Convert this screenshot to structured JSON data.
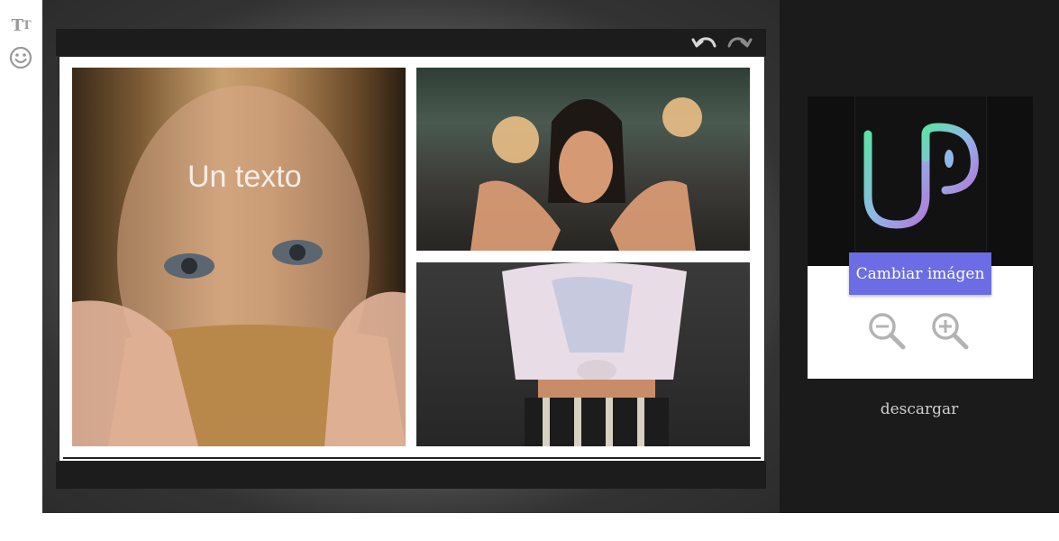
{
  "tools": {
    "text_glyph_big": "T",
    "text_glyph_small": "T"
  },
  "icons": {
    "text_tool": "text-size-icon",
    "emoji_tool": "smiley-icon",
    "undo": "undo-icon",
    "redo": "redo-icon",
    "zoom_out": "zoom-out-icon",
    "zoom_in": "zoom-in-icon"
  },
  "canvas": {
    "overlay_text": "Un texto"
  },
  "panel": {
    "change_image_label": "Cambiar imágen",
    "download_label": "descargar"
  },
  "colors": {
    "accent": "#6c6ce4",
    "panel_bg": "#1b1b1b",
    "logo_bg": "#0f0f0f"
  }
}
